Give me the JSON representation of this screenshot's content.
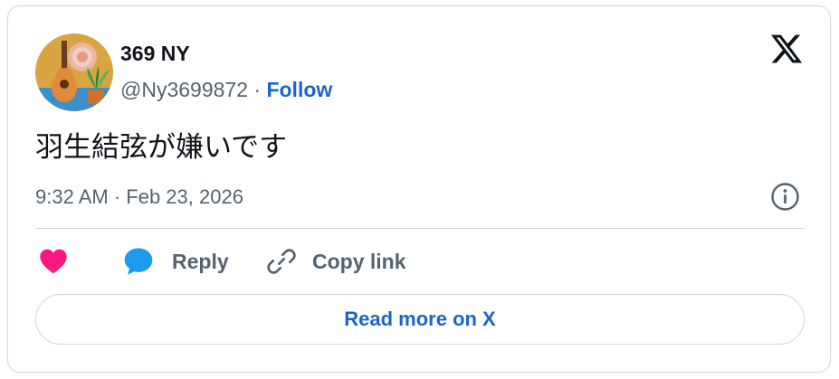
{
  "tweet": {
    "author": {
      "display_name": "369 NY",
      "handle": "@Ny3699872",
      "separator": "·",
      "follow_label": "Follow",
      "avatar_icon": "avatar-guitar-plant"
    },
    "text": "羽生結弦が嫌いです",
    "timestamp": "9:32 AM · Feb 23, 2026",
    "brand_icon": "x-logo-icon",
    "info_icon": "info-icon"
  },
  "actions": {
    "like": {
      "icon": "heart-icon",
      "color": "#f91880"
    },
    "reply": {
      "icon": "speech-bubble-icon",
      "label": "Reply",
      "color": "#1d9bf0"
    },
    "copy_link": {
      "icon": "link-icon",
      "label": "Copy link"
    }
  },
  "footer": {
    "read_more_label": "Read more on X"
  },
  "colors": {
    "text_primary": "#0f1419",
    "text_secondary": "#536471",
    "link": "#1d64c9",
    "border": "#cfd9de"
  }
}
